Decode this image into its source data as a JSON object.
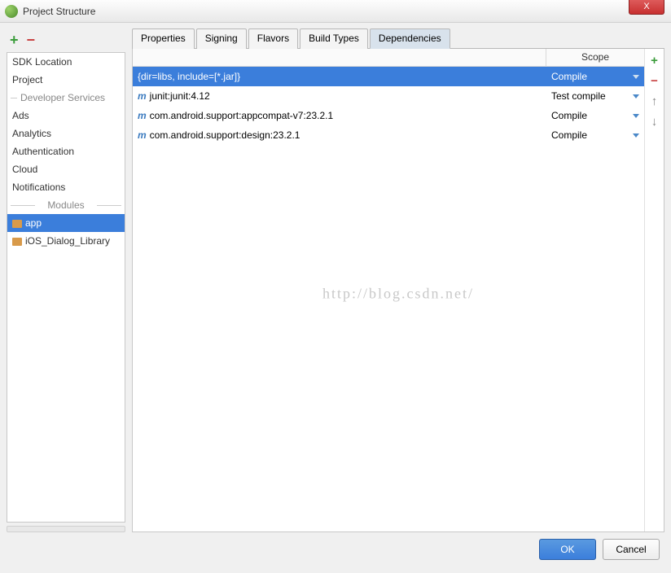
{
  "window": {
    "title": "Project Structure",
    "close": "X"
  },
  "sidebar": {
    "items": [
      "SDK Location",
      "Project"
    ],
    "dev_section": "Developer Services",
    "dev_items": [
      "Ads",
      "Analytics",
      "Authentication",
      "Cloud",
      "Notifications"
    ],
    "mod_section": "Modules",
    "modules": [
      {
        "name": "app",
        "selected": true
      },
      {
        "name": "iOS_Dialog_Library",
        "selected": false
      }
    ]
  },
  "tabs": [
    {
      "label": "Properties",
      "active": false
    },
    {
      "label": "Signing",
      "active": false
    },
    {
      "label": "Flavors",
      "active": false
    },
    {
      "label": "Build Types",
      "active": false
    },
    {
      "label": "Dependencies",
      "active": true
    }
  ],
  "dep_header": {
    "scope": "Scope"
  },
  "dependencies": [
    {
      "icon": "",
      "name": "{dir=libs, include=[*.jar]}",
      "scope": "Compile",
      "selected": true
    },
    {
      "icon": "m",
      "name": "junit:junit:4.12",
      "scope": "Test compile",
      "selected": false
    },
    {
      "icon": "m",
      "name": "com.android.support:appcompat-v7:23.2.1",
      "scope": "Compile",
      "selected": false
    },
    {
      "icon": "m",
      "name": "com.android.support:design:23.2.1",
      "scope": "Compile",
      "selected": false
    }
  ],
  "watermark": "http://blog.csdn.net/",
  "buttons": {
    "ok": "OK",
    "cancel": "Cancel"
  }
}
